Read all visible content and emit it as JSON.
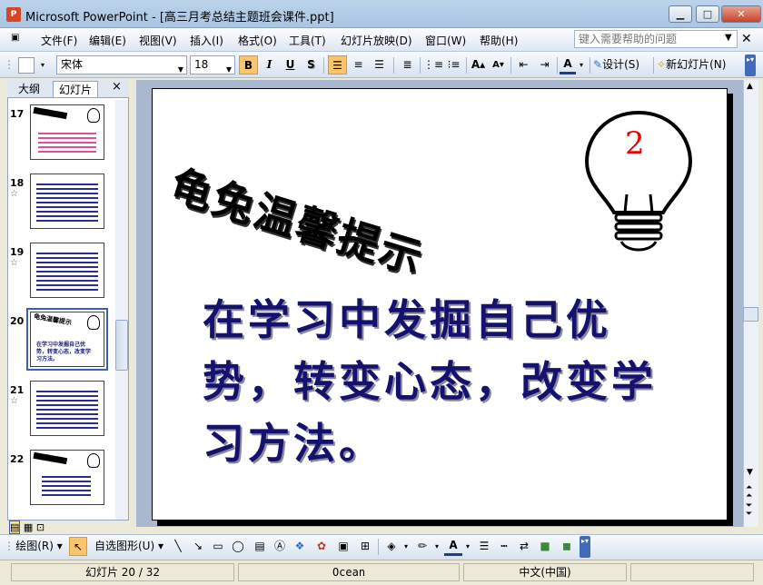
{
  "window": {
    "title": "Microsoft PowerPoint - [高三月考总结主题班会课件.ppt]",
    "app_icon": "P",
    "min_label": "▁",
    "max_label": "□",
    "close_label": "✕"
  },
  "menu": {
    "items": [
      "文件(F)",
      "编辑(E)",
      "视图(V)",
      "插入(I)",
      "格式(O)",
      "工具(T)",
      "幻灯片放映(D)",
      "窗口(W)",
      "帮助(H)"
    ],
    "help_placeholder": "键入需要帮助的问题"
  },
  "toolbar": {
    "font_name": "宋体",
    "font_size": "18",
    "bold": "B",
    "italic": "I",
    "underline": "U",
    "shadow": "S",
    "design_label": "设计(S)",
    "new_slide_label": "新幻灯片(N)",
    "font_color_label": "A"
  },
  "panel": {
    "tabs": [
      "大纲",
      "幻灯片"
    ],
    "close": "×",
    "thumbnails": [
      {
        "num": "17",
        "star": ""
      },
      {
        "num": "18",
        "star": "☆"
      },
      {
        "num": "19",
        "star": "☆"
      },
      {
        "num": "20",
        "star": ""
      },
      {
        "num": "21",
        "star": "☆"
      },
      {
        "num": "22",
        "star": ""
      }
    ],
    "thumb20_title": "龟兔温馨提示",
    "thumb20_body": "在学习中发掘自己优势，转变心态，改变学习方法。"
  },
  "slide": {
    "title": "龟兔温馨提示",
    "bulb_number": "2",
    "body": "在学习中发掘自己优势，转变心态，改变学习方法。"
  },
  "drawbar": {
    "draw_label": "绘图(R)",
    "autoshape_label": "自选图形(U)"
  },
  "status": {
    "slide_info": "幻灯片 20 / 32",
    "design": "Ocean",
    "language": "中文(中国)"
  },
  "colors": {
    "slide_body_text": "#14116f",
    "bulb_number": "#ee0000",
    "selection": "#3b62a8"
  }
}
